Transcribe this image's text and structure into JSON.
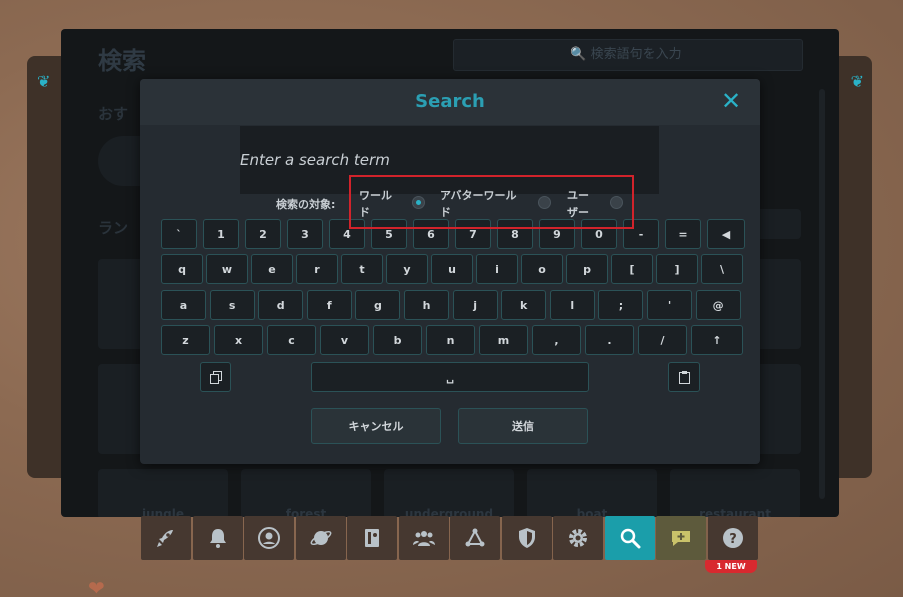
{
  "background_menu": {
    "title": "検索",
    "search_placeholder": "検索語句を入力",
    "section_recommended": "おす",
    "section_ranking": "ラン",
    "categories": [
      "jungle",
      "forest",
      "underground",
      "boat",
      "restaurant"
    ]
  },
  "modal": {
    "title": "Search",
    "search_placeholder": "Enter a search term",
    "target_label": "検索の対象:",
    "options": [
      {
        "label": "ワール\nド",
        "selected": true
      },
      {
        "label": "アバターワール\nド",
        "selected": false
      },
      {
        "label": "ユー\nザー",
        "selected": false
      }
    ],
    "keyboard": {
      "row1": [
        "`",
        "1",
        "2",
        "3",
        "4",
        "5",
        "6",
        "7",
        "8",
        "9",
        "0",
        "-",
        "=",
        "◀"
      ],
      "row2": [
        "q",
        "w",
        "e",
        "r",
        "t",
        "y",
        "u",
        "i",
        "o",
        "p",
        "[",
        "]",
        "\\"
      ],
      "row3": [
        "a",
        "s",
        "d",
        "f",
        "g",
        "h",
        "j",
        "k",
        "l",
        ";",
        "'",
        "@"
      ],
      "row4": [
        "z",
        "x",
        "c",
        "v",
        "b",
        "n",
        "m",
        ",",
        ".",
        "/",
        "↑"
      ],
      "space": "␣"
    },
    "cancel_label": "キャンセル",
    "submit_label": "送信"
  },
  "toolbar": {
    "items": [
      "rocket-icon",
      "bell-icon",
      "user-icon",
      "planet-icon",
      "avatar-book-icon",
      "people-icon",
      "network-icon",
      "shield-icon",
      "gear-icon",
      "search-icon",
      "chat-plus-icon",
      "help-icon"
    ],
    "badge": "1 NEW"
  },
  "colors": {
    "accent": "#2ab2c7",
    "highlight": "#d1232b",
    "key_border": "#2b5257",
    "active_tool": "#1b9eaa"
  }
}
